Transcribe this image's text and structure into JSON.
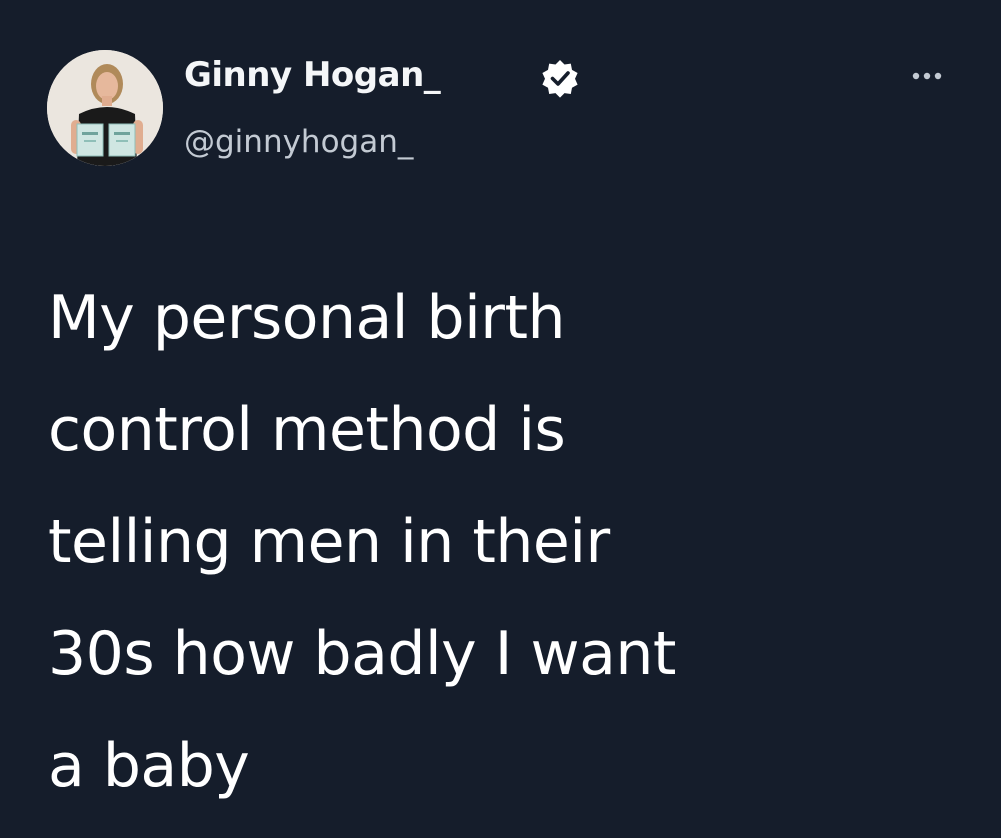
{
  "author": {
    "display_name": "Ginny Hogan_",
    "handle": "@ginnyhogan_",
    "verified": true,
    "avatar_icon": "profile-photo"
  },
  "menu": {
    "more_icon": "more-options-icon"
  },
  "tweet": {
    "lines": [
      "My personal birth",
      "control method is",
      "telling men in their",
      "30s how badly I want",
      "a baby"
    ]
  },
  "colors": {
    "background": "#151d2b",
    "text": "#ffffff",
    "handle": "#c3cad3"
  }
}
